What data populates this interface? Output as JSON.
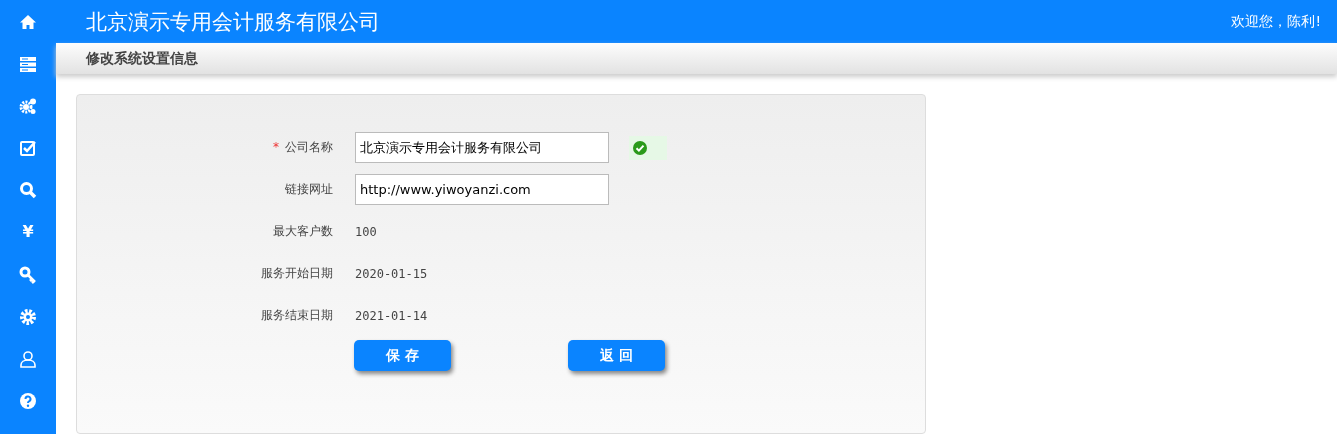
{
  "sidebar": {
    "items": [
      {
        "kind": "home"
      },
      {
        "kind": "server"
      },
      {
        "kind": "gears"
      },
      {
        "kind": "checkbox"
      },
      {
        "kind": "search"
      },
      {
        "kind": "glyph",
        "text": "¥"
      },
      {
        "kind": "key"
      },
      {
        "kind": "gear"
      },
      {
        "kind": "user"
      },
      {
        "kind": "help"
      }
    ]
  },
  "header": {
    "title": "北京演示专用会计服务有限公司",
    "welcome": "欢迎您，陈利!"
  },
  "page_title": "修改系统设置信息",
  "form": {
    "rows": [
      {
        "kind": "input",
        "label": "公司名称",
        "required": true,
        "required_mark": "*",
        "value": "北京演示专用会计服务有限公司",
        "valid": true
      },
      {
        "kind": "input",
        "label": "链接网址",
        "required": false,
        "value": "http://www.yiwoyanzi.com",
        "valid": false
      },
      {
        "kind": "text",
        "label": "最大客户数",
        "value": "100"
      },
      {
        "kind": "text",
        "label": "服务开始日期",
        "value": "2020-01-15"
      },
      {
        "kind": "text",
        "label": "服务结束日期",
        "value": "2021-01-14"
      }
    ],
    "buttons": [
      "保 存",
      "返 回"
    ]
  }
}
